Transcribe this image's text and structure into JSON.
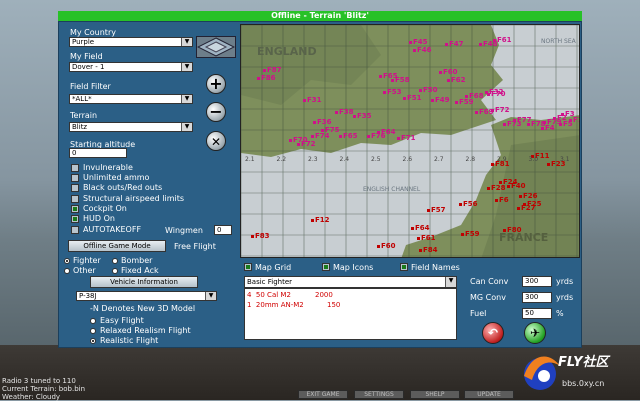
{
  "window": {
    "title": "Offline - Terrain 'Blitz'"
  },
  "my_country": {
    "label": "My Country",
    "value": "Purple"
  },
  "my_field": {
    "label": "My Field",
    "value": "Dover - 1"
  },
  "field_filter": {
    "label": "Field Filter",
    "value": "*ALL*"
  },
  "terrain": {
    "label": "Terrain",
    "value": "Blitz"
  },
  "starting_altitude": {
    "label": "Starting altitude",
    "value": "0"
  },
  "options": [
    {
      "label": "Invulnerable",
      "checked": false
    },
    {
      "label": "Unlimited ammo",
      "checked": false
    },
    {
      "label": "Black outs/Red outs",
      "checked": false
    },
    {
      "label": "Structural airspeed limits",
      "checked": false
    },
    {
      "label": "Cockpit On",
      "checked": true
    },
    {
      "label": "HUD On",
      "checked": true
    },
    {
      "label": "AUTOTAKEOFF",
      "checked": false
    }
  ],
  "wingmen": {
    "label": "Wingmen",
    "value": "0"
  },
  "mode": {
    "button_label": "Offline Game Mode",
    "status": "Free Flight"
  },
  "vehicle_types": [
    {
      "label": "Fighter",
      "selected": true
    },
    {
      "label": "Bomber",
      "selected": false
    },
    {
      "label": "Other",
      "selected": false
    },
    {
      "label": "Fixed Ack",
      "selected": false
    }
  ],
  "vehicle_info_button": "Vehicle Information",
  "vehicle": {
    "value": "P-38J"
  },
  "model_note": "-N Denotes New 3D Model",
  "realism": [
    {
      "label": "Easy Flight",
      "selected": false
    },
    {
      "label": "Relaxed Realism Flight",
      "selected": false
    },
    {
      "label": "Realistic Flight",
      "selected": true
    }
  ],
  "map_toggles": [
    {
      "label": "Map Grid",
      "checked": true
    },
    {
      "label": "Map Icons",
      "checked": true
    },
    {
      "label": "Field Names",
      "checked": true
    }
  ],
  "loadout": {
    "value": "Basic Fighter",
    "items": [
      {
        "qty": "4",
        "name": "50 Cal M2",
        "rounds": "2000"
      },
      {
        "qty": "1",
        "name": "20mm AN-M2",
        "rounds": "150"
      }
    ]
  },
  "convergence": {
    "can_conv": {
      "label": "Can Conv",
      "value": "300",
      "unit": "yrds"
    },
    "mg_conv": {
      "label": "MG Conv",
      "value": "300",
      "unit": "yrds"
    },
    "fuel": {
      "label": "Fuel",
      "value": "50",
      "unit": "%"
    }
  },
  "map_labels": {
    "england": "ENGLAND",
    "channel": "ENGLISH CHANNEL",
    "france": "FRANCE",
    "north_sea": "NORTH SEA"
  },
  "grid_numbers": [
    "2.1",
    "2.2",
    "2.3",
    "2.4",
    "2.5",
    "2.6",
    "2.7",
    "2.8",
    "2.9",
    "3.0",
    "3.1"
  ],
  "fields_purple": [
    "F45",
    "F47",
    "F46",
    "F48",
    "F61",
    "F87",
    "F86",
    "F65",
    "F58",
    "F60",
    "F62",
    "F50",
    "F51",
    "F49",
    "F53",
    "F59",
    "F68",
    "F69",
    "F70",
    "F72",
    "F32",
    "F36",
    "F31",
    "F38",
    "F35",
    "F74",
    "F75",
    "F76",
    "F64",
    "F65",
    "F71",
    "F70",
    "F72",
    "F73",
    "F77",
    "F78",
    "F79",
    "F2",
    "F3",
    "F4",
    "F5",
    "F1"
  ],
  "fields_red": [
    "F11",
    "F23",
    "F24",
    "F28",
    "F56",
    "F57",
    "F12",
    "F60",
    "F64",
    "F61",
    "F59",
    "F80",
    "F81",
    "F83",
    "F84",
    "F26",
    "F25",
    "F27",
    "F40",
    "F6"
  ],
  "hud": {
    "line1": "Radio 3 tuned to 110",
    "line2": "Current Terrain: bob.bin",
    "line3": "Weather: Cloudy"
  },
  "bottom_buttons": [
    "EXIT GAME",
    "SETTINGS",
    "SHELP",
    "UPDATE"
  ],
  "logo": {
    "brand": "FLY社区",
    "url": "bbs.0xy.cn"
  },
  "colors": {
    "title_bar": "#27c127",
    "panel": "#2b5f86",
    "field_purple": "#d0108a",
    "field_red": "#c00000"
  }
}
